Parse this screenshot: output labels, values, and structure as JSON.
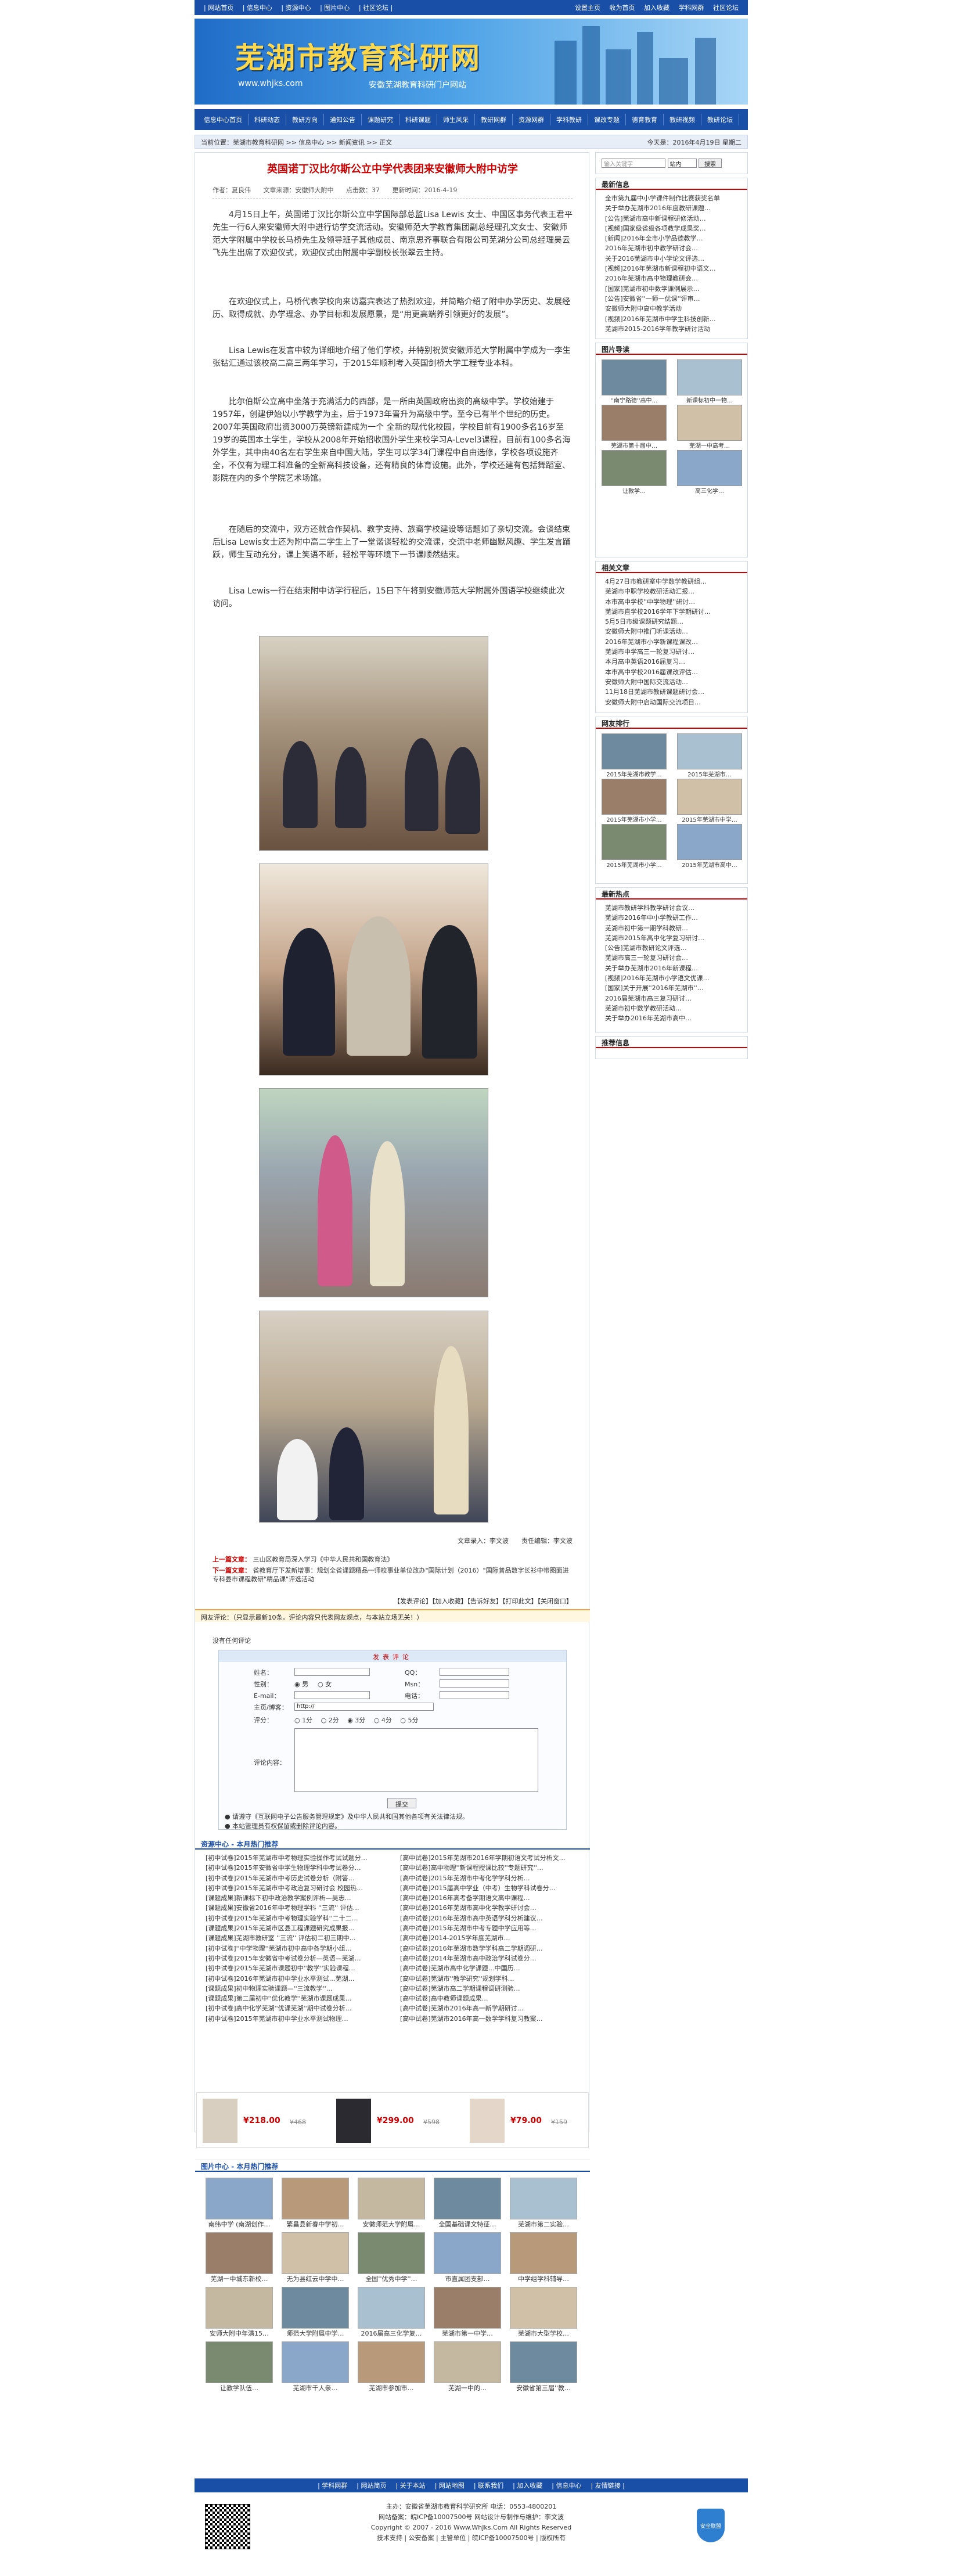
{
  "top": {
    "left": [
      "| 网站首页",
      "| 信息中心",
      "| 资源中心",
      "| 图片中心",
      "| 社区论坛 |"
    ],
    "right": [
      "设置主页",
      "收为首页",
      "加入收藏",
      "学科网群",
      "社区论坛"
    ]
  },
  "banner": {
    "logo": "芜湖市教育科研网",
    "url": "www.whjks.com",
    "sub": "安徽芜湖教育科研门户网站"
  },
  "nav": [
    "信息中心首页",
    "科研动态",
    "教研方向",
    "通知公告",
    "课题研究",
    "科研课题",
    "师生风采",
    "教研网群",
    "资源网群",
    "学科教研",
    "课改专题",
    "德育教育",
    "教研视频",
    "教研论坛",
    "网站首页",
    "最新更新"
  ],
  "bread": {
    "text": "当前位置：芜湖市教育科研网 >> 信息中心 >> 新闻资讯 >> 正文",
    "right": "今天是：2016年4月19日 星期二"
  },
  "article": {
    "title": "英国诺丁汉比尔斯公立中学代表团来安徽师大附中访学",
    "meta": [
      "作者：夏良伟",
      "文章来源：安徽师大附中",
      "点击数：37",
      "更新时间：2016-4-19"
    ],
    "p1": "4月15日上午，英国诺丁汉比尔斯公立中学国际部总监Lisa Lewis 女士、中国区事务代表王君平先生一行6人来安徽师大附中进行访学交流活动。安徽师范大学教育集团副总经理孔文女士、安徽师范大学附属中学校长马桥先生及领导班子其他成员、南京思齐事联合有限公司芜湖分公司总经理吴云飞先生出席了欢迎仪式，欢迎仪式由附属中学副校长张翠云主持。",
    "p2": "在欢迎仪式上，马桥代表学校向来访嘉宾表达了热烈欢迎，并简略介绍了附中办学历史、发展经历、取得成就、办学理念、办学目标和发展愿景，是“用更高端养引领更好的发展”。",
    "p3": "Lisa Lewis在发言中较为详细地介绍了他们学校，并特别祝贺安徽师范大学附属中学成为一李生张钻汇通过该校高二高三两年学习，于2015年顺利考入英国剑桥大学工程专业本科。",
    "p4": "比尔伯斯公立高中坐落于充满活力的西部，是一所由英国政府出资的高级中学。学校始建于1957年，创建伊始以小学教学为主，后于1973年晋升为高级中学。至今已有半个世纪的历史。2007年英国政府出资3000万英镑新建成为一个 全新的现代化校园，学校目前有1900多名16岁至19岁的英国本土学生，学校从2008年开始招收国外学生来校学习A-Level3课程，目前有100多名海外学生，其中由40名左右学生来自中国大陆，学生可以学34门课程中自由选修，学校各项设施齐全，不仅有为理工科准备的全新高科技设备，还有精良的体育设施。此外，学校还建有包括舞蹈室、影院在内的多个学院艺术场馆。",
    "p5": "在随后的交流中，双方还就合作契机、教学支持、族裔学校建设等话题如了亲切交流。会谈结束后Lisa Lewis女士还为附中高二学生上了一堂谐谈轻松的交流课，交流中老师幽默风趣、学生发言踊跃，师生互动充分，课上笑语不断，轻松平等环境下一节课顺然结束。",
    "p6": "Lisa Lewis一行在结束附中访学行程后，15日下午将到安徽师范大学附属外国语学校继续此次访问。",
    "editor": "文章录入：李文波　　责任编辑：李文波"
  },
  "pn": {
    "prev_label": "上一篇文章：",
    "prev": "三山区教育局深入学习《中华人民共和国教育法》",
    "next_label": "下一篇文章：",
    "next": "省教育厅下发新增事：规划全省课题精品一师校事业单位改办\"国际计划（2016）\"国际普品数字长衫中带图面进专科县市课程教研\"精品课\"评选活动"
  },
  "tools": "【发表评论】【加入收藏】【告诉好友】【打印此文】【关闭窗口】",
  "comment": {
    "bar": "网友评论：（只显示最新10条。评论内容只代表网友观点，与本站立场无关！）",
    "none": "没有任何评论",
    "form_title": "发表评论",
    "labels": [
      "姓名：",
      "性别：",
      "E-mail：",
      "主页/博客：",
      "评分：",
      "评论内容："
    ],
    "right_labels": [
      "QQ：",
      "Msn：",
      "电话："
    ],
    "gender": [
      "男",
      "女"
    ],
    "url_value": "http://",
    "scores": [
      "1分",
      "2分",
      "3分",
      "4分",
      "5分"
    ],
    "submit": "提交",
    "notes": [
      "请遵守《互联网电子公告服务管理规定》及中华人民共和国其他各项有关法律法规。",
      "本站管理员有权保留或删除评论内容。"
    ]
  },
  "resources": {
    "title": "资源中心 - 本月热门推荐",
    "left": [
      "[初中试卷]2015年芜湖市中考物理实验操作考试试题分…",
      "[初中试卷]2015年安徽省中学生物理学科中考试卷分…",
      "[初中试卷]2015年芜湖市中考历史试卷分析（附答…",
      "[初中试卷]2015年芜湖市中考政治复习研讨会 校园热…",
      "[课题成果]新课标下初中政治教学案例评析—吴志…",
      "[课题成果]安徽省2016年中考物理学科 ''三流'' 评估…",
      "[初中试卷]2015年芜湖市中考物理实验学科''二十二…",
      "[课题成果]2015年芜湖市区县工程课题研究成果报…",
      "[课题成果]芜湖市教研室 ''三流'' 评估初二初三期中…",
      "[初中试卷]''中学物理''芜湖市初中高中各学期小组…",
      "[初中试卷]2015年安徽省中考试卷分析—英语—芜湖…",
      "[初中试卷]2015年芜湖市课题初中''教学''实验课程…",
      "[初中试卷]2016年芜湖市初中学业水平测试…芜湖…",
      "[课题成果]初中物理实验课题—''三流教学''…",
      "[课题成果]第二届初中''优化教学''芜湖市课题成果…",
      "[初中试卷]高中化学芜湖''优课芜湖''期中试卷分析…",
      "[初中试卷]2015年芜湖市初中学业水平测试物理…"
    ],
    "right": [
      "[高中试卷]2015年芜湖市2016年学期初语文考试分析文…",
      "[高中试卷]高中物理''新课程授课比较''专题研究''…",
      "[高中试卷]2015年芜湖市中考化学学科分析…",
      "[高中试卷]2015届高中学业（中考）生物学科试卷分…",
      "[高中试卷]2016年高考备学期语文高中课程…",
      "[高中试卷]2016年芜湖市高中化学教学研讨会…",
      "[高中试卷]2016年芜湖市高中英语学科分析建议…",
      "[高中试卷]2015年芜湖市中考专题中学应用等…",
      "[高中试卷]2014-2015学年度芜湖市…",
      "[高中试卷]2016年芜湖市数学学科高二学期调研…",
      "[高中试卷]2014年芜湖市高中政治学科试卷分…",
      "[高中试卷]芜湖市高中化学课题…中国历…",
      "[高中试卷]芜湖市''教学研究''规划学科…",
      "[高中试卷]芜湖市高二学期课程调研测验…",
      "[高中试卷]高中教师课题成果…",
      "[高中试卷]芜湖市2016年高一新学期研讨…",
      "[高中试卷]芜湖市2016年高一数学学科复习教案…"
    ]
  },
  "ads": [
    {
      "price": "¥218.00",
      "old": "¥468"
    },
    {
      "price": "¥299.00",
      "old": "¥598"
    },
    {
      "price": "¥79.00",
      "old": "¥159"
    }
  ],
  "photos": {
    "title": "图片中心 - 本月热门推荐",
    "caps": [
      "南纬中学 (南湖创作…",
      "繁昌县新春中学初…",
      "安徽师范大学附属…",
      "全国基础课文特征…",
      "芜湖市第二实验…",
      "芜湖一中城东新校…",
      "无为县红云中学中…",
      "全国''优秀中学''…",
      "市直属团支部…",
      "中学组学科辅导…",
      "安师大附中年满15…",
      "师范大学附属中学…",
      "2016届高三化学复…",
      "芜湖市第一中学…",
      "芜湖市大型学校…",
      "让教学队伍…",
      "芜湖市千人亲…",
      "芜湖市参加市…",
      "芜湖一中的…",
      "安徽省第三届''教…"
    ]
  },
  "foot": {
    "links": [
      "| 学科网群",
      "| 网站简页",
      "| 关于本站",
      "| 网站地图",
      "| 联系我们",
      "| 加入收藏",
      "| 信息中心",
      "| 友情链接 |"
    ],
    "lines": [
      "主办：安徽省芜湖市教育科学研究所  电话：0553-4800201",
      "网站备案：皖ICP备10007500号   网站设计与制作与维护：李文波",
      "Copyright © 2007 - 2016 Www.WhJks.Com All Rights Reserved",
      "技术支持  |  公安备案  |  主管单位  |  皖ICP备10007500号  |  版权所有"
    ],
    "shield": "安全联盟"
  },
  "side": {
    "search": {
      "placeholder": "输入关键字",
      "range": "站内",
      "btn": "搜索"
    },
    "latest": {
      "title": "最新信息",
      "items": [
        "全市第九届中小学课件制作比赛获奖名单",
        "关于举办芜湖市2016年度教研课题…",
        "[公告]芜湖市高中新课程研修活动…",
        "[视频]国家级省级各项教学成果奖…",
        "[新闻]2016年全市小学品德教学…",
        "2016年芜湖市初中教学研讨会…",
        "关于2016芜湖市中小学论文评选…",
        "[视频]2016年芜湖市新课程初中语文…",
        "2016年芜湖市高中物理教研会…",
        "[国家]芜湖市初中数学课例展示…",
        "[公告]安徽省''一师一优课''评审…",
        "安徽师大附中高中教学活动",
        "[视频]2016年芜湖市中学生科技创新…",
        "芜湖市2015-2016学年教学研讨活动"
      ]
    },
    "photos": {
      "title": "图片导读",
      "caps": [
        "''南宁路德''高中…",
        "新课标初中一物…",
        "芜湖市第十届中…",
        "芜湖一中高考…",
        "让教学…",
        "高三化学…"
      ]
    },
    "related": {
      "title": "相关文章",
      "items": [
        "4月27日市教研室中学数学教研组…",
        "芜湖市中职学校教研活动汇报…",
        "本市高中学校''中学物理''研讨…",
        "芜湖市直学校2016学年下学期研讨…",
        "5月5日市级课题研究结题…",
        "安徽师大附中推门听课活动…",
        "2016年芜湖市小学新课程课改…",
        "芜湖市中学高三一轮复习研讨…",
        "本月高中英语2016届复习…",
        "本市高中学校2016届课改评估…",
        "安徽师大附中国际交流活动…",
        "11月18日芜湖市教研课题研讨会…",
        "安徽师大附中启动国际交流项目…"
      ]
    },
    "rank": {
      "title": "网友排行",
      "caps": [
        "2015年芜湖市教学…",
        "2015年芜湖市…",
        "2015年芜湖市小学…",
        "2015年芜湖市中学…",
        "2015年芜湖市小学…",
        "2015年芜湖市高中…"
      ]
    },
    "hot": {
      "title": "最新热点",
      "items": [
        "芜湖市教研学科教学研讨会议…",
        "芜湖市2016年中小学教研工作…",
        "芜湖市初中第一期学科教研…",
        "芜湖市2015年高中化学复习研讨…",
        "[公告]芜湖市教研论文评选…",
        "芜湖市高三一轮复习研讨会…",
        "关于举办芜湖市2016年新课程…",
        "[视频]2016年芜湖市小学语文优课…",
        "[国家]关于开展''2016年芜湖市''…",
        "2016届芜湖市高三复习研讨…",
        "芜湖市初中数学教研活动…",
        "关于举办2016年芜湖市高中…"
      ]
    },
    "recommend": {
      "title": "推荐信息"
    }
  }
}
